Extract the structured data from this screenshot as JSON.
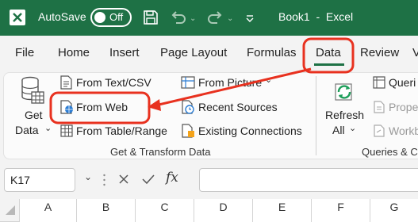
{
  "title_bar": {
    "autosave_label": "AutoSave",
    "autosave_state": "Off",
    "document_title": "Book1  -  Excel"
  },
  "tabs": [
    "File",
    "Home",
    "Insert",
    "Page Layout",
    "Formulas",
    "Data",
    "Review",
    "V"
  ],
  "ribbon": {
    "get_data": {
      "line1": "Get",
      "line2": "Data"
    },
    "from_text_csv": "From Text/CSV",
    "from_web": "From Web",
    "from_table_range": "From Table/Range",
    "from_picture": "From Picture",
    "recent_sources": "Recent Sources",
    "existing_connections": "Existing Connections",
    "group_get_transform": "Get & Transform Data",
    "refresh": {
      "line1": "Refresh",
      "line2": "All"
    },
    "queries": "Queri",
    "properties": "Prope",
    "workbook_links": "Workb",
    "group_queries": "Queries & C"
  },
  "formula_bar": {
    "name_box": "K17",
    "fx": "fx"
  },
  "column_headers": [
    "A",
    "B",
    "C",
    "D",
    "E",
    "F",
    "G"
  ],
  "colors": {
    "excel_green": "#1e7145",
    "annotation_red": "#e8311f"
  }
}
